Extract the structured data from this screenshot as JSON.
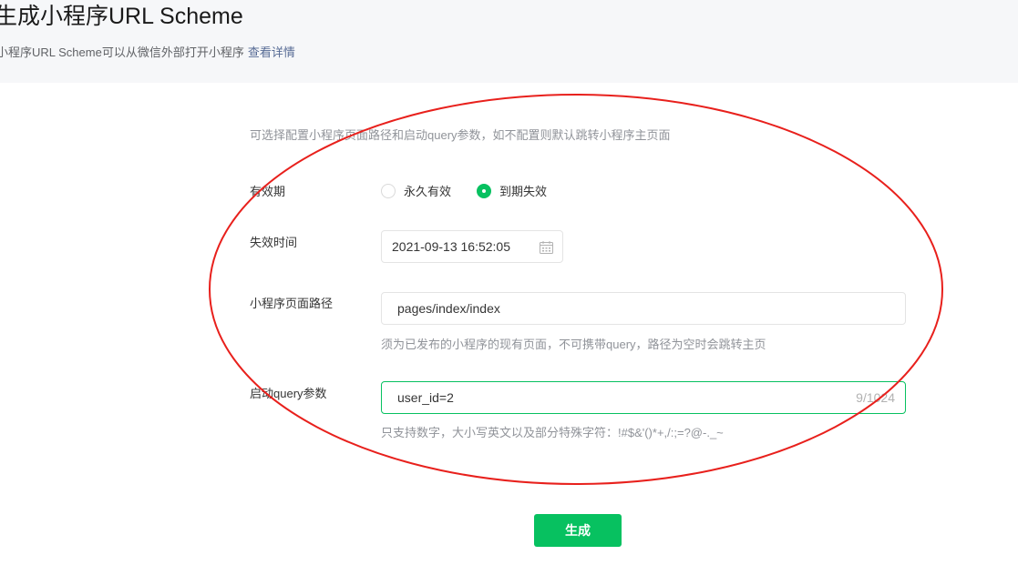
{
  "header": {
    "title": "生成小程序URL Scheme",
    "subtitle": "小程序URL Scheme可以从微信外部打开小程序",
    "detail_link": "查看详情"
  },
  "form": {
    "intro": "可选择配置小程序页面路径和启动query参数，如不配置则默认跳转小程序主页面",
    "validity": {
      "label": "有效期",
      "options": [
        "永久有效",
        "到期失效"
      ],
      "selected": "到期失效"
    },
    "expire_time": {
      "label": "失效时间",
      "value": "2021-09-13 16:52:05",
      "icon": "calendar-icon"
    },
    "page_path": {
      "label": "小程序页面路径",
      "value": "pages/index/index",
      "hint": "须为已发布的小程序的现有页面，不可携带query，路径为空时会跳转主页"
    },
    "query": {
      "label": "启动query参数",
      "value": "user_id=2",
      "counter": "9/1024",
      "hint": "只支持数字，大小写英文以及部分特殊字符：!#$&'()*+,/:;=?@-._~"
    },
    "submit_label": "生成"
  },
  "colors": {
    "accent": "#07c160",
    "link": "#576b95",
    "annotation": "#e8201c"
  }
}
